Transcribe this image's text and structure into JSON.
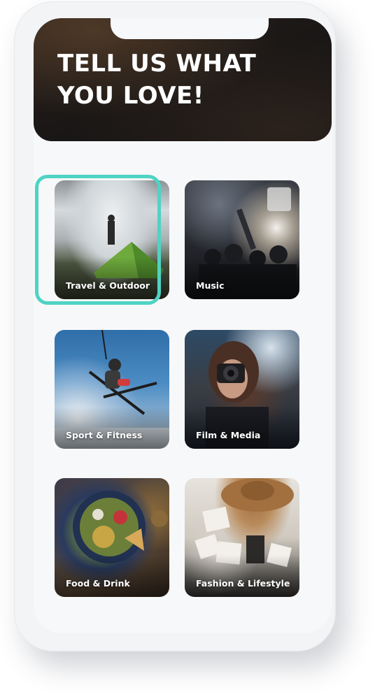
{
  "header": {
    "title": "TELL US WHAT\nYOU LOVE!"
  },
  "categories": [
    {
      "label": "Travel & Outdoor",
      "selected": true
    },
    {
      "label": "Music",
      "selected": false
    },
    {
      "label": "Sport & Fitness",
      "selected": false
    },
    {
      "label": "Film & Media",
      "selected": false
    },
    {
      "label": "Food & Drink",
      "selected": false
    },
    {
      "label": "Fashion & Lifestyle",
      "selected": false
    }
  ],
  "colors": {
    "accent": "#4fd3c4",
    "header_bg": "#1a1716",
    "screen_bg": "#f7f8f9"
  }
}
